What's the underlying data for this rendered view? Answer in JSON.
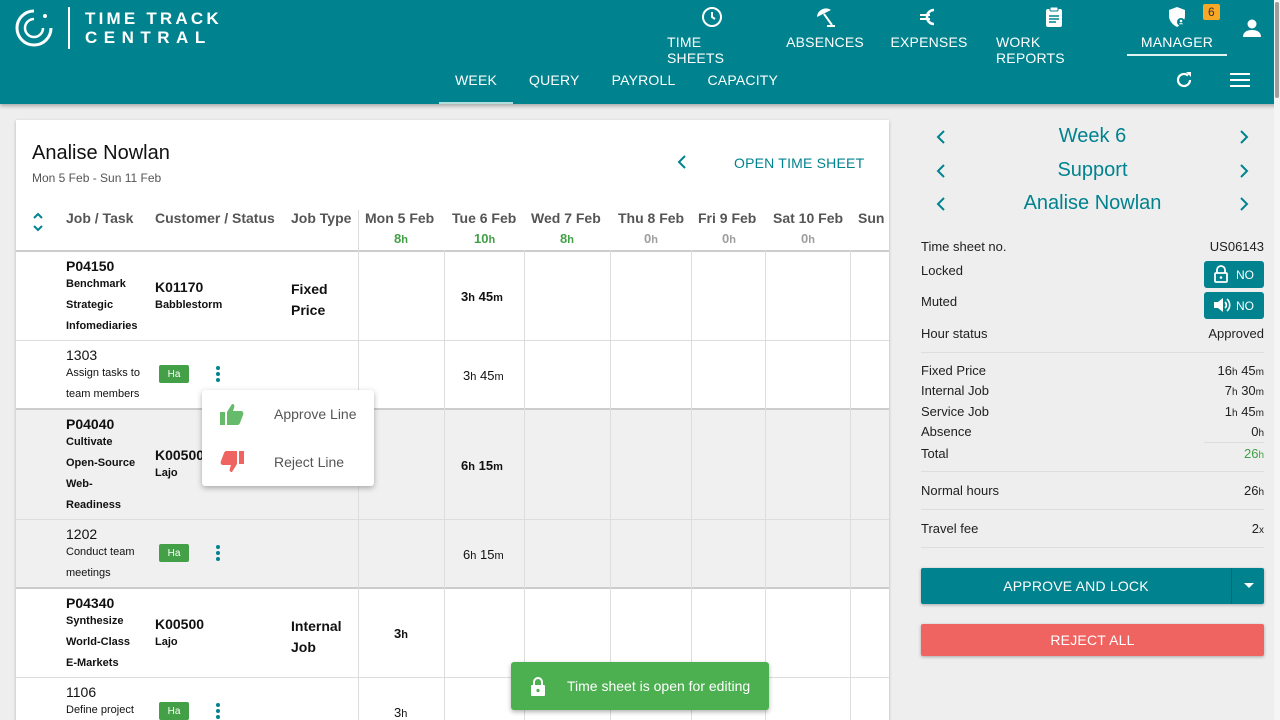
{
  "app": {
    "logo_line1": "TIME TRACK",
    "logo_line2": "CENTRAL"
  },
  "nav": [
    {
      "label": "TIME SHEETS",
      "icon": "clock-icon"
    },
    {
      "label": "ABSENCES",
      "icon": "beach-umbrella-icon"
    },
    {
      "label": "EXPENSES",
      "icon": "euro-icon"
    },
    {
      "label": "WORK REPORTS",
      "icon": "clipboard-icon"
    },
    {
      "label": "MANAGER",
      "icon": "shield-user-icon",
      "badge": "6",
      "active": true
    }
  ],
  "subnav": [
    {
      "label": "WEEK",
      "active": true
    },
    {
      "label": "QUERY"
    },
    {
      "label": "PAYROLL"
    },
    {
      "label": "CAPACITY"
    }
  ],
  "sheet": {
    "employee": "Analise Nowlan",
    "range": "Mon 5 Feb - Sun 11 Feb",
    "open_label": "OPEN TIME SHEET",
    "columns": {
      "job": "Job / Task",
      "customer": "Customer / Status",
      "type": "Job Type",
      "days": [
        {
          "label": "Mon 5 Feb",
          "num": "8",
          "unit": "h",
          "color": "#43a047"
        },
        {
          "label": "Tue 6 Feb",
          "num": "10",
          "unit": "h",
          "color": "#43a047"
        },
        {
          "label": "Wed 7 Feb",
          "num": "8",
          "unit": "h",
          "color": "#43a047"
        },
        {
          "label": "Thu 8 Feb",
          "num": "0",
          "unit": "h",
          "color": "#9e9e9e"
        },
        {
          "label": "Fri 9 Feb",
          "num": "0",
          "unit": "h",
          "color": "#9e9e9e"
        },
        {
          "label": "Sat 10 Feb",
          "num": "0",
          "unit": "h",
          "color": "#9e9e9e"
        },
        {
          "label": "Sun",
          "num": "",
          "unit": "",
          "color": "#9e9e9e"
        }
      ]
    },
    "jobs": [
      {
        "code": "P04150",
        "name_lines": [
          "Benchmark",
          "Strategic",
          "Infomediaries"
        ],
        "customer_code": "K01170",
        "customer_name": "Babblestorm",
        "type_lines": [
          "Fixed",
          "Price"
        ],
        "total_h": "3",
        "total_m": "45",
        "task": {
          "code": "1303",
          "name_lines": [
            "Assign tasks to",
            "team members"
          ],
          "status": "Ha",
          "h": "3",
          "m": "45"
        }
      },
      {
        "code": "P04040",
        "name_lines": [
          "Cultivate",
          "Open-Source",
          "Web-",
          "Readiness"
        ],
        "customer_code": "K00500",
        "customer_name": "Lajo",
        "type_lines": [],
        "total_h": "6",
        "total_m": "15",
        "task": {
          "code": "1202",
          "name_lines": [
            "Conduct team",
            "meetings"
          ],
          "status": "Ha",
          "h": "6",
          "m": "15"
        }
      },
      {
        "code": "P04340",
        "name_lines": [
          "Synthesize",
          "World-Class",
          "E-Markets"
        ],
        "customer_code": "K00500",
        "customer_name": "Lajo",
        "type_lines": [
          "Internal",
          "Job"
        ],
        "total_h": "3",
        "total_m": "",
        "task": {
          "code": "1106",
          "name_lines": [
            "Define project"
          ],
          "status": "Ha",
          "h": "3",
          "m": ""
        }
      }
    ]
  },
  "context_menu": {
    "approve": "Approve Line",
    "reject": "Reject Line"
  },
  "toast": {
    "text": "Time sheet is open for editing"
  },
  "panel": {
    "week": "Week 6",
    "group": "Support",
    "employee": "Analise Nowlan",
    "sheet_no_label": "Time sheet no.",
    "sheet_no": "US06143",
    "locked_label": "Locked",
    "locked_value": "NO",
    "muted_label": "Muted",
    "muted_value": "NO",
    "status_label": "Hour status",
    "status_value": "Approved",
    "fixed_label": "Fixed Price",
    "fixed_h": "16",
    "fixed_m": "45",
    "internal_label": "Internal Job",
    "internal_h": "7",
    "internal_m": "30",
    "service_label": "Service Job",
    "service_h": "1",
    "service_m": "45",
    "absence_label": "Absence",
    "absence_h": "0",
    "total_label": "Total",
    "total_h": "26",
    "normal_label": "Normal hours",
    "normal_h": "26",
    "travel_label": "Travel fee",
    "travel_value": "2",
    "travel_unit": "x",
    "approve_label": "APPROVE AND LOCK",
    "reject_label": "REJECT ALL"
  },
  "units": {
    "h": "h",
    "m": "m"
  },
  "colors": {
    "brand": "#00838f",
    "success": "#43a047",
    "danger": "#ef6461",
    "badge": "#f9a825"
  }
}
